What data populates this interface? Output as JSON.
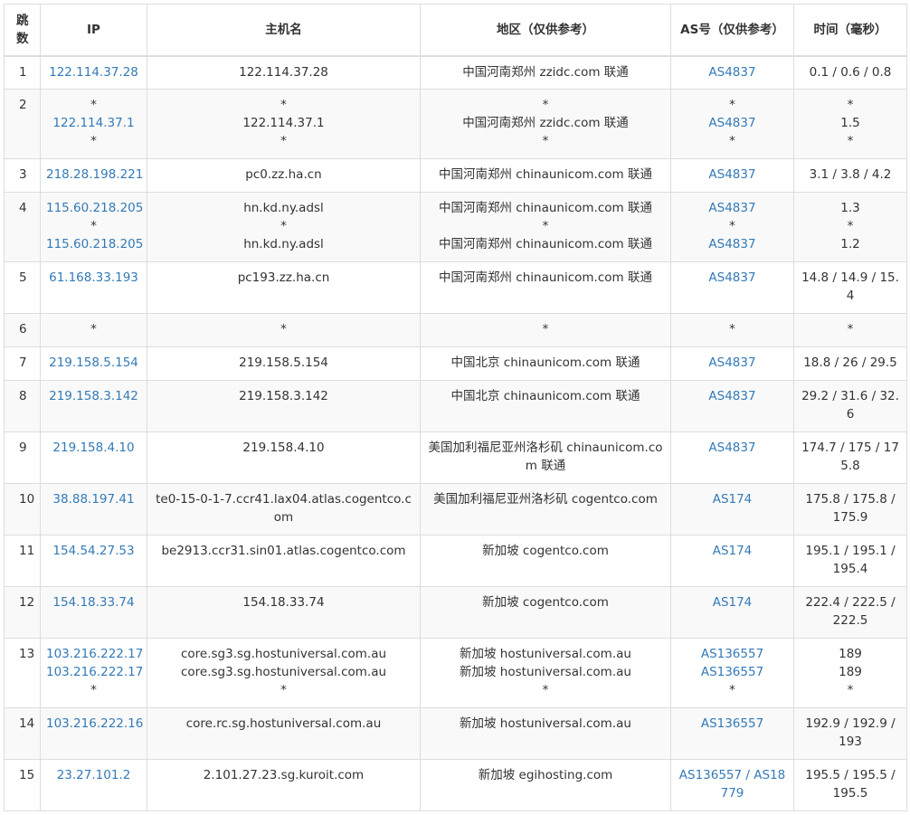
{
  "headers": {
    "hop": [
      "跳",
      "数"
    ],
    "ip": "IP",
    "host": "主机名",
    "region": "地区（仅供参考）",
    "asn": "AS号（仅供参考）",
    "time": "时间（毫秒）"
  },
  "rows": [
    {
      "hop": "1",
      "ip": [
        "122.114.37.28"
      ],
      "host": [
        "122.114.37.28"
      ],
      "region": [
        "中国河南郑州 zzidc.com 联通"
      ],
      "asn": [
        "AS4837"
      ],
      "time": [
        "0.1 / 0.6 / 0.8"
      ]
    },
    {
      "hop": "2",
      "ip": [
        "*",
        "122.114.37.1",
        "*"
      ],
      "host": [
        "*",
        "122.114.37.1",
        "*"
      ],
      "region": [
        "*",
        "中国河南郑州 zzidc.com 联通",
        "*"
      ],
      "asn": [
        "*",
        "AS4837",
        "*"
      ],
      "time": [
        "*",
        "1.5",
        "*"
      ]
    },
    {
      "hop": "3",
      "ip": [
        "218.28.198.221"
      ],
      "host": [
        "pc0.zz.ha.cn"
      ],
      "region": [
        "中国河南郑州 chinaunicom.com 联通"
      ],
      "asn": [
        "AS4837"
      ],
      "time": [
        "3.1 / 3.8 / 4.2"
      ]
    },
    {
      "hop": "4",
      "ip": [
        "115.60.218.205",
        "*",
        "115.60.218.205"
      ],
      "host": [
        "hn.kd.ny.adsl",
        "*",
        "hn.kd.ny.adsl"
      ],
      "region": [
        "中国河南郑州 chinaunicom.com 联通",
        "*",
        "中国河南郑州 chinaunicom.com 联通"
      ],
      "asn": [
        "AS4837",
        "*",
        "AS4837"
      ],
      "time": [
        "1.3",
        "*",
        "1.2"
      ]
    },
    {
      "hop": "5",
      "ip": [
        "61.168.33.193"
      ],
      "host": [
        "pc193.zz.ha.cn"
      ],
      "region": [
        "中国河南郑州 chinaunicom.com 联通"
      ],
      "asn": [
        "AS4837"
      ],
      "time": [
        "14.8 / 14.9 / 15.4"
      ]
    },
    {
      "hop": "6",
      "ip": [
        "*"
      ],
      "host": [
        "*"
      ],
      "region": [
        "*"
      ],
      "asn": [
        "*"
      ],
      "time": [
        "*"
      ]
    },
    {
      "hop": "7",
      "ip": [
        "219.158.5.154"
      ],
      "host": [
        "219.158.5.154"
      ],
      "region": [
        "中国北京 chinaunicom.com 联通"
      ],
      "asn": [
        "AS4837"
      ],
      "time": [
        "18.8 / 26 / 29.5"
      ]
    },
    {
      "hop": "8",
      "ip": [
        "219.158.3.142"
      ],
      "host": [
        "219.158.3.142"
      ],
      "region": [
        "中国北京 chinaunicom.com 联通"
      ],
      "asn": [
        "AS4837"
      ],
      "time": [
        "29.2 / 31.6 / 32.6"
      ]
    },
    {
      "hop": "9",
      "ip": [
        "219.158.4.10"
      ],
      "host": [
        "219.158.4.10"
      ],
      "region": [
        "美国加利福尼亚州洛杉矶 chinaunicom.com 联通"
      ],
      "asn": [
        "AS4837"
      ],
      "time": [
        "174.7 / 175 / 175.8"
      ]
    },
    {
      "hop": "10",
      "ip": [
        "38.88.197.41"
      ],
      "host": [
        "te0-15-0-1-7.ccr41.lax04.atlas.cogentco.com"
      ],
      "region": [
        "美国加利福尼亚州洛杉矶 cogentco.com"
      ],
      "asn": [
        "AS174"
      ],
      "time": [
        "175.8 / 175.8 / 175.9"
      ]
    },
    {
      "hop": "11",
      "ip": [
        "154.54.27.53"
      ],
      "host": [
        "be2913.ccr31.sin01.atlas.cogentco.com"
      ],
      "region": [
        "新加坡 cogentco.com"
      ],
      "asn": [
        "AS174"
      ],
      "time": [
        "195.1 / 195.1 / 195.4"
      ]
    },
    {
      "hop": "12",
      "ip": [
        "154.18.33.74"
      ],
      "host": [
        "154.18.33.74"
      ],
      "region": [
        "新加坡 cogentco.com"
      ],
      "asn": [
        "AS174"
      ],
      "time": [
        "222.4 / 222.5 / 222.5"
      ]
    },
    {
      "hop": "13",
      "ip": [
        "103.216.222.17",
        "103.216.222.17",
        "*"
      ],
      "host": [
        "core.sg3.sg.hostuniversal.com.au",
        "core.sg3.sg.hostuniversal.com.au",
        "*"
      ],
      "region": [
        "新加坡 hostuniversal.com.au",
        "新加坡 hostuniversal.com.au",
        "*"
      ],
      "asn": [
        "AS136557",
        "AS136557",
        "*"
      ],
      "time": [
        "189",
        "189",
        "*"
      ]
    },
    {
      "hop": "14",
      "ip": [
        "103.216.222.16"
      ],
      "host": [
        "core.rc.sg.hostuniversal.com.au"
      ],
      "region": [
        "新加坡 hostuniversal.com.au"
      ],
      "asn": [
        "AS136557"
      ],
      "time": [
        "192.9 / 192.9 / 193"
      ]
    },
    {
      "hop": "15",
      "ip": [
        "23.27.101.2"
      ],
      "host": [
        "2.101.27.23.sg.kuroit.com"
      ],
      "region": [
        "新加坡 egihosting.com"
      ],
      "asn": [
        "AS136557 / AS18779"
      ],
      "time": [
        "195.5 / 195.5 / 195.5"
      ]
    }
  ],
  "colors": {
    "link": "#337ab7",
    "border": "#dddddd",
    "text": "#333333",
    "stripe": "#f9f9f9"
  }
}
